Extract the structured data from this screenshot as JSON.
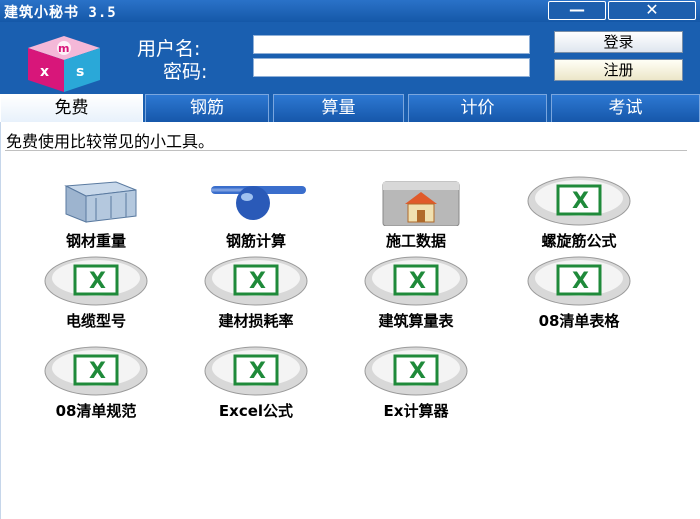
{
  "window": {
    "title": "建筑小秘书 3.5",
    "minimize_glyph": "—",
    "close_glyph": "✕"
  },
  "login": {
    "username_label": "用户名:",
    "password_label": "密码:",
    "username_value": "",
    "password_value": "",
    "login_button": "登录",
    "register_button": "注册"
  },
  "tabs": [
    {
      "label": "免费",
      "active": true
    },
    {
      "label": "钢筋",
      "active": false
    },
    {
      "label": "算量",
      "active": false
    },
    {
      "label": "计价",
      "active": false
    },
    {
      "label": "考试",
      "active": false
    }
  ],
  "panel": {
    "description": "免费使用比较常见的小工具。"
  },
  "tools": [
    {
      "label": "钢材重量",
      "icon": "steel-weight-icon"
    },
    {
      "label": "钢筋计算",
      "icon": "rebar-calc-icon"
    },
    {
      "label": "施工数据",
      "icon": "construction-data-icon"
    },
    {
      "label": "螺旋筋公式",
      "icon": "excel-icon"
    },
    {
      "label": "电缆型号",
      "icon": "excel-icon"
    },
    {
      "label": "建材损耗率",
      "icon": "excel-icon"
    },
    {
      "label": "建筑算量表",
      "icon": "excel-icon"
    },
    {
      "label": "08清单表格",
      "icon": "excel-icon"
    },
    {
      "label": "08清单规范",
      "icon": "excel-icon"
    },
    {
      "label": "Excel公式",
      "icon": "excel-icon"
    },
    {
      "label": "Ex计算器",
      "icon": "excel-icon"
    }
  ],
  "colors": {
    "titlebar": "#1558a8",
    "excel_green": "#1f8a3a"
  }
}
